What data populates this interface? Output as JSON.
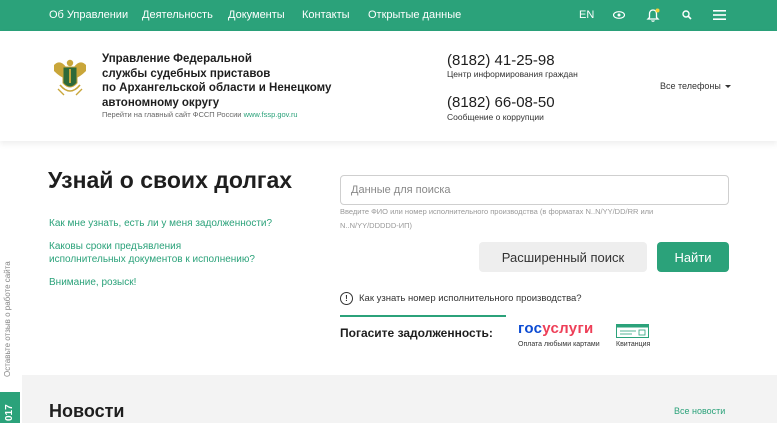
{
  "topnav": {
    "items": [
      "Об Управлении",
      "Деятельность",
      "Документы",
      "Контакты",
      "Открытые данные"
    ],
    "lang": "EN",
    "icons": [
      "eye-icon",
      "bell-icon",
      "search-icon",
      "menu-icon"
    ]
  },
  "header": {
    "org_name_lines": [
      "Управление Федеральной",
      "службы судебных приставов",
      "по Архангельской области и Ненецкому",
      "автономному округу"
    ],
    "main_site_text": "Перейти на главный сайт ФССП России",
    "main_site_url": "www.fssp.gov.ru",
    "phones": [
      {
        "number": "(8182) 41-25-98",
        "label": "Центр информирования граждан"
      },
      {
        "number": "(8182) 66-08-50",
        "label": "Сообщение о коррупции"
      }
    ],
    "all_phones": "Все телефоны"
  },
  "main": {
    "title": "Узнай о своих долгах",
    "faq": [
      "Как мне узнать, есть ли у меня задолженности?",
      "Каковы сроки предъявления исполнительных документов к исполнению?",
      "Внимание, розыск!"
    ],
    "search": {
      "placeholder": "Данные для поиска",
      "value": "",
      "hint": "Введите ФИО или номер исполнительного производства (в форматах N..N/YY/DD/RR или N..N/YY/DDDDD-ИП)"
    },
    "advanced_search": "Расширенный поиск",
    "find": "Найти",
    "info_question": "Как узнать номер исполнительного производства?",
    "pay": {
      "label": "Погасите задолженность:",
      "gosuslugi_part1": "гос",
      "gosuslugi_part2": "услуги",
      "gosuslugi_sub": "Оплата любыми картами",
      "receipt": "Квитанция"
    }
  },
  "sidebar": {
    "feedback": "Оставьте отзыв о работе сайта",
    "badge": "017"
  },
  "news": {
    "title": "Новости",
    "all": "Все новости"
  },
  "colors": {
    "brand_green": "#2ba27a",
    "gosuslugi_blue": "#0d4cd3",
    "gosuslugi_red": "#ee3f58"
  }
}
